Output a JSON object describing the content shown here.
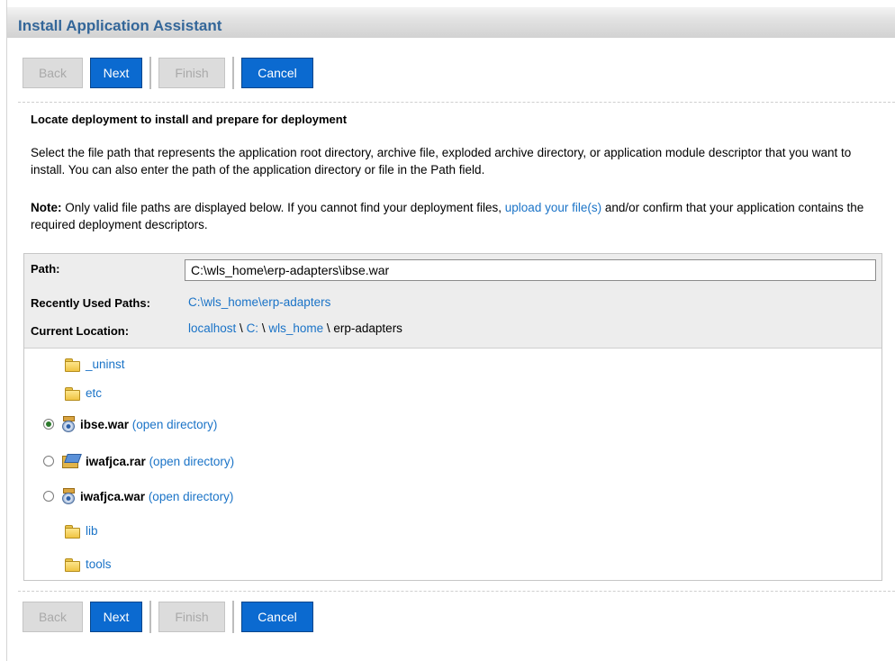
{
  "window": {
    "title": "Install Application Assistant"
  },
  "buttons": {
    "back": "Back",
    "next": "Next",
    "finish": "Finish",
    "cancel": "Cancel"
  },
  "page": {
    "heading": "Locate deployment to install and prepare for deployment",
    "description": "Select the file path that represents the application root directory, archive file, exploded archive directory, or application module descriptor that you want to install. You can also enter the path of the application directory or file in the Path field.",
    "note_label": "Note:",
    "note_text_before": " Only valid file paths are displayed below. If you cannot find your deployment files, ",
    "note_link": "upload your file(s)",
    "note_text_after": " and/or confirm that your application contains the required deployment descriptors."
  },
  "form": {
    "path_label": "Path:",
    "path_value": "C:\\wls_home\\erp-adapters\\ibse.war",
    "recent_label": "Recently Used Paths:",
    "recent_value": "C:\\wls_home\\erp-adapters",
    "location_label": "Current Location:",
    "location": {
      "host": "localhost",
      "sep1": " \\ ",
      "drive": "C: ",
      "sep2": "\\ ",
      "home": "wls_home",
      "sep3": " \\ ",
      "current": "erp-adapters"
    }
  },
  "entries": [
    {
      "name": "_uninst",
      "kind": "folder"
    },
    {
      "name": "etc",
      "kind": "folder"
    },
    {
      "name": "ibse.war",
      "kind": "archive",
      "selected": true,
      "open_label": "(open directory)"
    },
    {
      "name": "iwafjca.rar",
      "kind": "rar",
      "selected": false,
      "open_label": "(open directory)"
    },
    {
      "name": "iwafjca.war",
      "kind": "archive",
      "selected": false,
      "open_label": "(open directory)"
    },
    {
      "name": "lib",
      "kind": "folder"
    },
    {
      "name": "tools",
      "kind": "folder"
    }
  ],
  "colors": {
    "title": "#336699",
    "link": "#1a73c7",
    "primary_button": "#0b6ad0",
    "disabled_button": "#dcdcdc"
  }
}
